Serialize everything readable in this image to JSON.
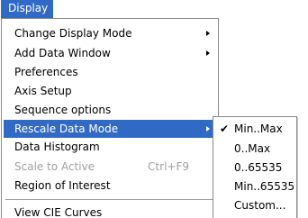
{
  "menubar": {
    "display_label": "Display"
  },
  "display_menu": {
    "items": [
      {
        "label": "Change Display Mode",
        "submenu": true
      },
      {
        "label": "Add Data Window",
        "submenu": true
      },
      {
        "label": "Preferences"
      },
      {
        "label": "Axis Setup"
      },
      {
        "label": "Sequence options"
      },
      {
        "label": "Rescale Data Mode",
        "submenu": true,
        "highlighted": true
      },
      {
        "label": "Data Histogram"
      },
      {
        "label": "Scale to Active",
        "shortcut": "Ctrl+F9",
        "disabled": true
      },
      {
        "label": "Region of Interest"
      },
      {
        "label": "View CIE Curves"
      }
    ]
  },
  "rescale_submenu": {
    "check_mark": "✔",
    "items": [
      {
        "label": "Min..Max",
        "checked": true
      },
      {
        "label": "0..Max"
      },
      {
        "label": "0..65535"
      },
      {
        "label": "Min..65535"
      },
      {
        "label": "Custom..."
      }
    ]
  }
}
